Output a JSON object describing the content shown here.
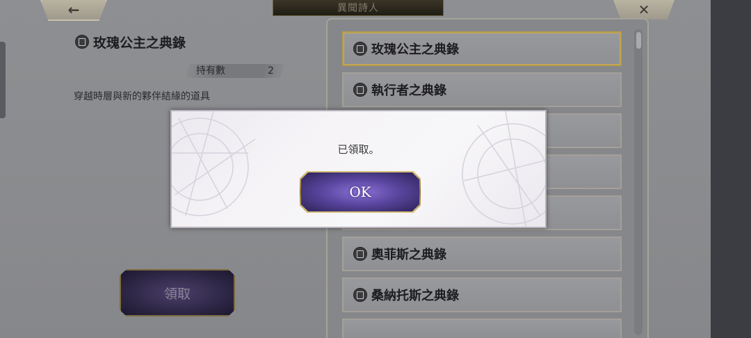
{
  "header": {
    "title": "異聞詩人",
    "back_icon": "←",
    "close_icon": "✕"
  },
  "detail": {
    "title": "玫瑰公主之典錄",
    "owned_label": "持有數",
    "owned_value": "2",
    "description": "穿越時層與新的夥伴結緣的道具",
    "claim_label": "領取"
  },
  "list": {
    "items": [
      {
        "label": "玫瑰公主之典錄"
      },
      {
        "label": "執行者之典錄"
      },
      {
        "label": ""
      },
      {
        "label": ""
      },
      {
        "label": ""
      },
      {
        "label": "奧菲斯之典錄"
      },
      {
        "label": "桑納托斯之典錄"
      },
      {
        "label": ""
      }
    ]
  },
  "modal": {
    "message": "已領取。",
    "ok_label": "OK"
  },
  "colors": {
    "accent_gold": "#c7ad5c",
    "button_purple": "#5a47a0"
  }
}
